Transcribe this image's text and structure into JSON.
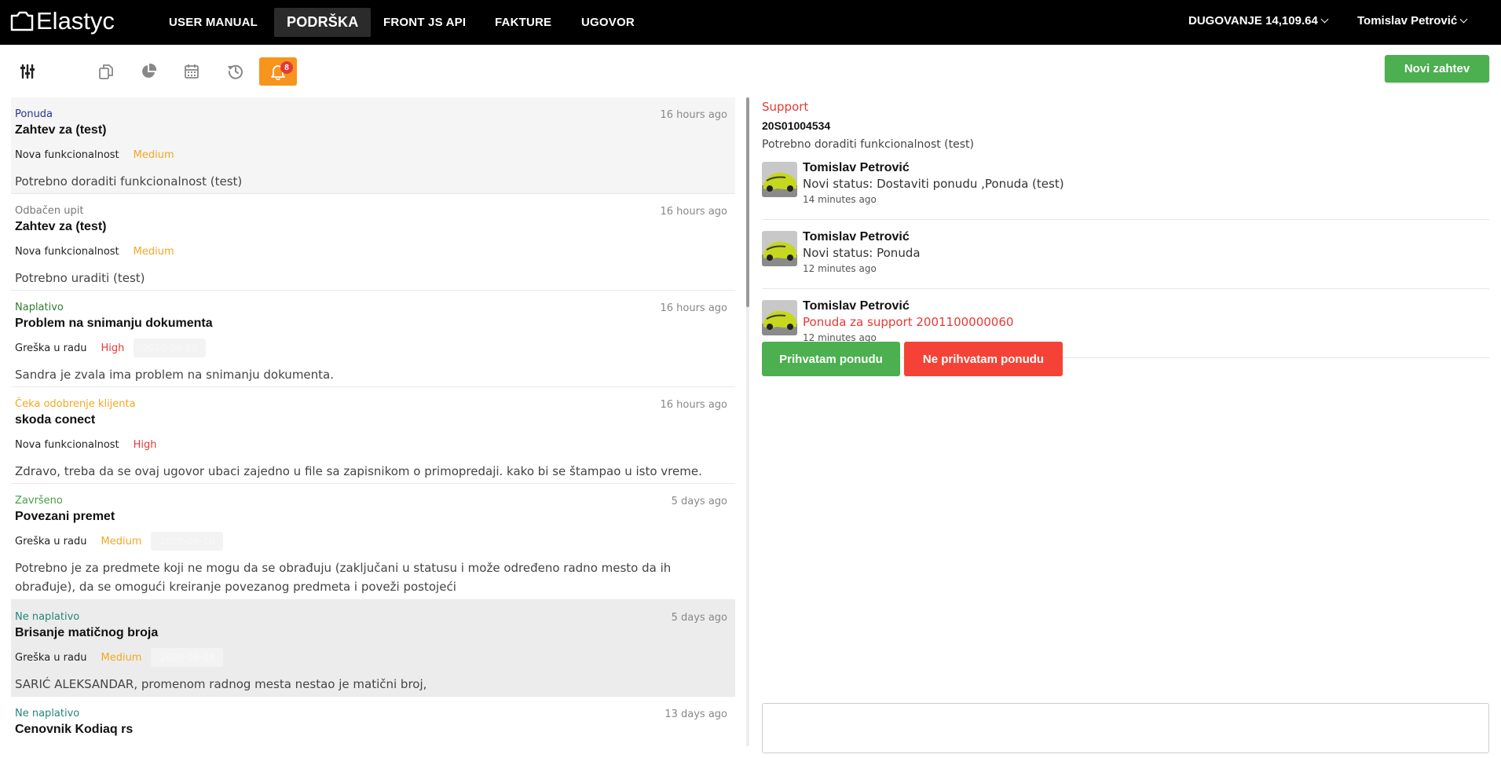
{
  "app": {
    "name": "Elastyc"
  },
  "nav": {
    "items": [
      "USER MANUAL",
      "PODRŠKA",
      "FRONT JS API",
      "FAKTURE",
      "UGOVOR"
    ],
    "active": "PODRŠKA",
    "debt": "DUGOVANJE 14,109.64",
    "user": "Tomislav Petrović"
  },
  "toolbar": {
    "icons": [
      "filter-sliders-icon",
      "copy-icon",
      "pie-chart-icon",
      "calendar-icon",
      "history-icon",
      "bell-icon"
    ],
    "notification_count": "8",
    "new_request": "Novi zahtev"
  },
  "tickets": [
    {
      "status": "Ponuda",
      "status_color": "#283593",
      "time": "16 hours ago",
      "title": "Zahtev za (test)",
      "type": "Nova funkcionalnost",
      "priority": "Medium",
      "priority_color": "#f5a623",
      "date": "",
      "desc": "Potrebno doraditi funkcionalnost (test)"
    },
    {
      "status": "Odbačen upit",
      "status_color": "#777777",
      "time": "16 hours ago",
      "title": "Zahtev za (test)",
      "type": "Nova funkcionalnost",
      "priority": "Medium",
      "priority_color": "#f5a623",
      "date": "",
      "desc": "Potrebno uraditi (test)"
    },
    {
      "status": "Naplativo",
      "status_color": "#2e7d32",
      "time": "16 hours ago",
      "title": "Problem na snimanju dokumenta",
      "type": "Greška u radu",
      "priority": "High",
      "priority_color": "#e53935",
      "date": "2020-06-18",
      "desc": "Sandra je zvala ima problem na snimanju dokumenta."
    },
    {
      "status": "Čeka odobrenje klijenta",
      "status_color": "#f5a623",
      "time": "16 hours ago",
      "title": "skoda conect",
      "type": "Nova funkcionalnost",
      "priority": "High",
      "priority_color": "#e53935",
      "date": "",
      "desc": "Zdravo, treba da se ovaj ugovor ubaci zajedno u file sa zapisnikom o primopredaji. kako bi se štampao u isto vreme."
    },
    {
      "status": "Završeno",
      "status_color": "#43a047",
      "time": "5 days ago",
      "title": "Povezani premet",
      "type": "Greška u radu",
      "priority": "Medium",
      "priority_color": "#f5a623",
      "date": "2020-06-10",
      "desc": "Potrebno je za predmete koji ne mogu da se obrađuju (zaključani u statusu i može određeno radno mesto da ih obrađuje), da se omogući kreiranje povezanog predmeta i poveži postojeći"
    },
    {
      "status": "Ne naplativo",
      "status_color": "#26867a",
      "time": "5 days ago",
      "title": "Brisanje matičnog broja",
      "type": "Greška u radu",
      "priority": "Medium",
      "priority_color": "#f5a623",
      "date": "2020-06-09",
      "desc": "SARIĆ ALEKSANDAR, promenom radnog mesta nestao je matični broj,"
    },
    {
      "status": "Ne naplativo",
      "status_color": "#26867a",
      "time": "13 days ago",
      "title": "Cenovnik Kodiaq rs",
      "type": "",
      "priority": "",
      "priority_color": "#f5a623",
      "date": "",
      "desc": ""
    }
  ],
  "detail": {
    "category": "Support",
    "number": "20S01004534",
    "description": "Potrebno doraditi funkcionalnost (test)",
    "comments": [
      {
        "author": "Tomislav Petrović",
        "text": "Novi status: Dostaviti ponudu ,Ponuda (test)",
        "time": "14 minutes ago"
      },
      {
        "author": "Tomislav Petrović",
        "text": "Novi status: Ponuda",
        "time": "12 minutes ago"
      },
      {
        "author": "Tomislav Petrović",
        "text": "Ponuda za support 2001100000060",
        "time": "12 minutes ago"
      }
    ],
    "accept": "Prihvatam ponudu",
    "reject": "Ne prihvatam ponudu",
    "reply_value": ""
  }
}
